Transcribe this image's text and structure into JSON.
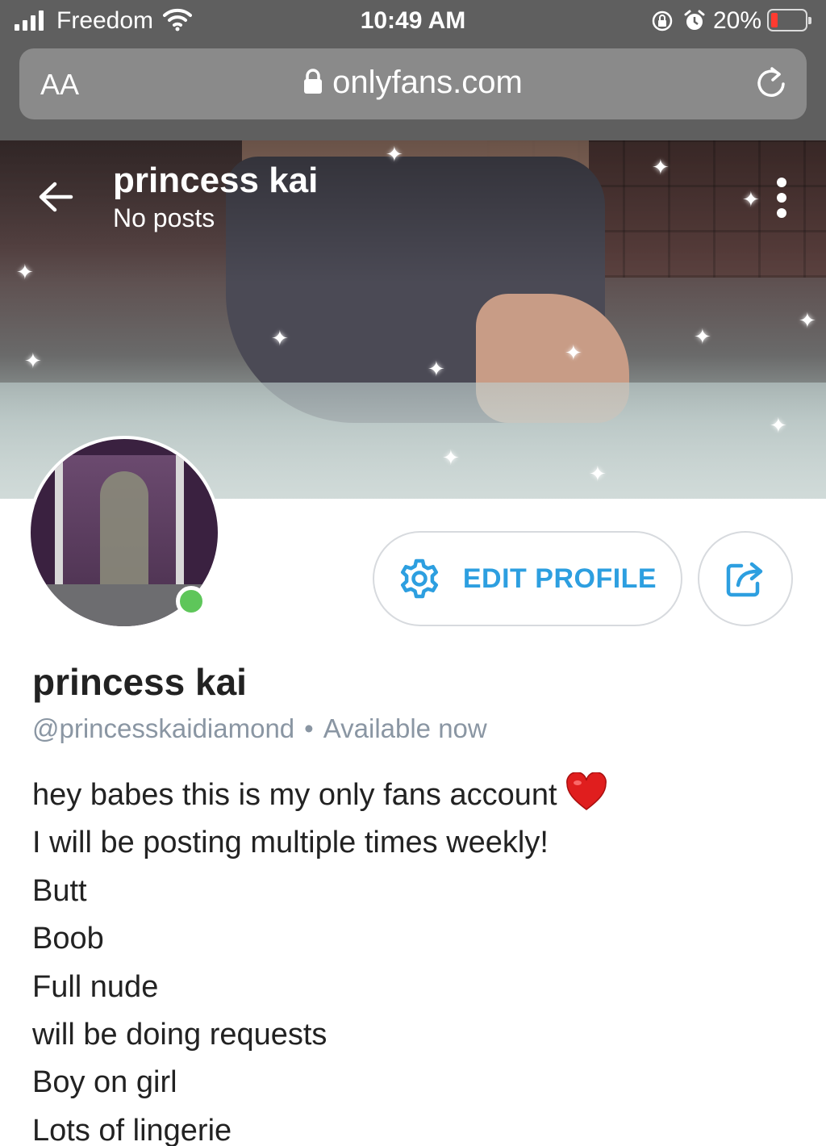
{
  "status_bar": {
    "carrier": "Freedom",
    "time": "10:49 AM",
    "battery_percent": "20%",
    "battery_level": 0.2,
    "icons": [
      "signal-icon",
      "wifi-icon",
      "rotation-lock-icon",
      "alarm-icon",
      "battery-icon"
    ]
  },
  "browser": {
    "text_size_button": "AA",
    "url": "onlyfans.com",
    "icons": [
      "padlock-icon",
      "reload-icon"
    ]
  },
  "cover": {
    "title": "princess kai",
    "subtitle": "No posts",
    "icons": [
      "back-arrow-icon",
      "more-vertical-icon"
    ]
  },
  "profile": {
    "name": "princess kai",
    "handle": "@princesskaidiamond",
    "separator": "•",
    "availability": "Available now",
    "status_color": "#5ec65a",
    "edit_button": "EDIT PROFILE",
    "accent_color": "#2d9fe0",
    "icons": [
      "gear-icon",
      "share-icon",
      "heart-icon"
    ]
  },
  "bio": {
    "lines": [
      "hey babes this is my only fans account",
      "I will be posting multiple times weekly!",
      "Butt",
      "Boob",
      "Full nude",
      "will be doing requests",
      "Boy on girl",
      "Lots of lingerie"
    ]
  }
}
